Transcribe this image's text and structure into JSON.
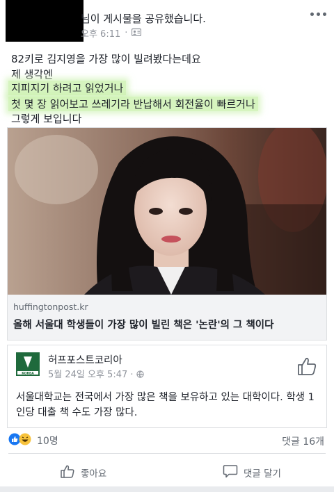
{
  "header": {
    "share_text": "님이 게시물을 공유했습니다.",
    "time": "오후 6:11",
    "dot": "·"
  },
  "post": {
    "lines": [
      "82키로 김지영을 가장 많이 빌려봤다는데요",
      "제 생각엔",
      "지피지기 하려고 읽었거나",
      "첫 몇 장 읽어보고 쓰레기라 반납해서 회전율이 빠르거나",
      "그렇게 보입니다"
    ]
  },
  "link": {
    "domain": "huffingtonpost.kr",
    "title": "올해 서울대 학생들이 가장 많이 빌린 책은 '논란'의 그 책이다"
  },
  "embed": {
    "page_name": "허프포스트코리아",
    "logo_text": "KOREA",
    "date": "5월 24일 오후 5:47",
    "dot": "·",
    "text": "서울대학교는 전국에서 가장 많은 책을 보유하고 있는 대학이다. 학생 1인당 대출 책 수도 가장 많다."
  },
  "footer": {
    "reaction_count": "10명",
    "comment_count": "댓글 16개",
    "like_label": "좋아요",
    "comment_label": "댓글 달기"
  },
  "colors": {
    "highlight": "#c8f0aa",
    "facebook_blue": "#1877f2",
    "logo_green": "#1f6a3c"
  }
}
